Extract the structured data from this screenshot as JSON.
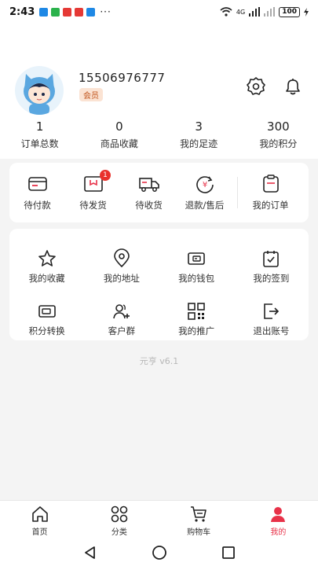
{
  "status_bar": {
    "time": "2:43",
    "app_icon_colors": [
      "#1e88e5",
      "#2bb24c",
      "#e53935",
      "#e53935",
      "#1e88e5"
    ],
    "more": "···",
    "network": "4G",
    "battery": "100"
  },
  "profile": {
    "phone": "15506976777",
    "member_badge": "会员"
  },
  "stats": [
    {
      "value": "1",
      "label": "订单总数"
    },
    {
      "value": "0",
      "label": "商品收藏"
    },
    {
      "value": "3",
      "label": "我的足迹"
    },
    {
      "value": "300",
      "label": "我的积分"
    }
  ],
  "orders": {
    "items": [
      {
        "label": "待付款",
        "icon": "wallet-card-icon"
      },
      {
        "label": "待发货",
        "icon": "box-icon",
        "badge": "1"
      },
      {
        "label": "待收货",
        "icon": "truck-icon"
      },
      {
        "label": "退款/售后",
        "icon": "refund-icon"
      }
    ],
    "all_label": "我的订单"
  },
  "tools": [
    {
      "label": "我的收藏",
      "icon": "star-icon"
    },
    {
      "label": "我的地址",
      "icon": "location-pin-icon"
    },
    {
      "label": "我的钱包",
      "icon": "wallet-icon"
    },
    {
      "label": "我的签到",
      "icon": "calendar-check-icon"
    },
    {
      "label": "积分转换",
      "icon": "points-card-icon"
    },
    {
      "label": "客户群",
      "icon": "user-group-add-icon"
    },
    {
      "label": "我的推广",
      "icon": "qr-code-icon"
    },
    {
      "label": "退出账号",
      "icon": "logout-icon"
    }
  ],
  "version": "元亨 v6.1",
  "tabbar": {
    "items": [
      {
        "label": "首页",
        "icon": "home-icon"
      },
      {
        "label": "分类",
        "icon": "grid-icon"
      },
      {
        "label": "购物车",
        "icon": "cart-icon"
      },
      {
        "label": "我的",
        "icon": "user-icon",
        "active": true
      }
    ]
  },
  "colors": {
    "accent": "#e83249",
    "badge": "#e9322c",
    "member_text": "#c1541c",
    "member_bg": "#fbe3d3"
  }
}
